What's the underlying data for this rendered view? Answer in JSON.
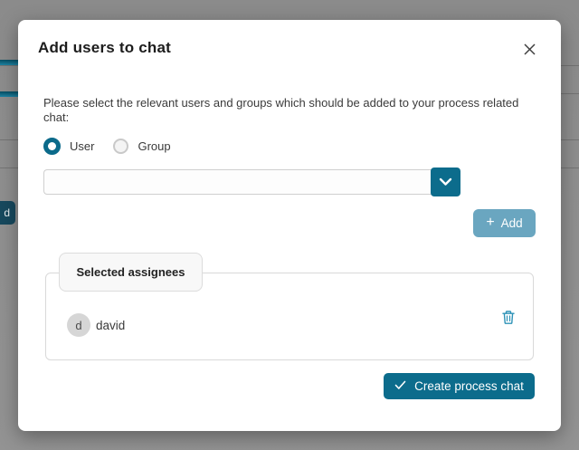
{
  "backdrop": {
    "badge_text": "d"
  },
  "modal": {
    "title": "Add users to chat",
    "description": "Please select the relevant users and groups which should be added to your process related chat:",
    "radios": {
      "options": [
        {
          "label": "User",
          "selected": true
        },
        {
          "label": "Group",
          "selected": false
        }
      ]
    },
    "user_select": {
      "value": "",
      "placeholder": ""
    },
    "add_button": {
      "label": "Add",
      "plus_glyph": "+"
    },
    "assignees": {
      "tab_label": "Selected assignees",
      "items": [
        {
          "initial": "d",
          "name": "david"
        }
      ]
    },
    "create_button": {
      "label": "Create process chat"
    }
  },
  "colors": {
    "primary": "#0c6c8c",
    "primary_disabled": "#6aa6c0",
    "icon_accent": "#2d92b7",
    "overlay_gray": "#909090"
  }
}
